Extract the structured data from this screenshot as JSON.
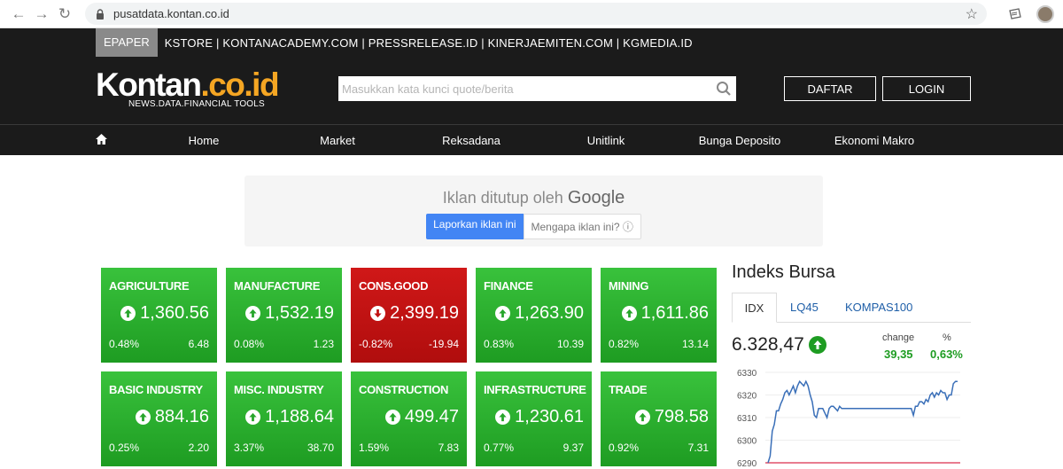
{
  "browser": {
    "url": "pusatdata.kontan.co.id"
  },
  "topbar": {
    "epaper": "EPAPER",
    "links": "KSTORE | KONTANACADEMY.COM | PRESSRELEASE.ID | KINERJAEMITEN.COM | KGMEDIA.ID"
  },
  "header": {
    "logo_main": "Kontan",
    "logo_accent": ".co.id",
    "tagline": "NEWS.DATA.FINANCIAL TOOLS",
    "search_placeholder": "Masukkan kata kunci quote/berita",
    "daftar": "DAFTAR",
    "login": "LOGIN"
  },
  "nav": [
    "Home",
    "Market",
    "Reksadana",
    "Unitlink",
    "Bunga Deposito",
    "Ekonomi Makro"
  ],
  "ad": {
    "closed_text": "Iklan ditutup oleh",
    "brand": "Google",
    "report": "Laporkan iklan ini",
    "why": "Mengapa iklan ini? ⓘ"
  },
  "sectors": [
    {
      "name": "AGRICULTURE",
      "value": "1,360.56",
      "pct": "0.48%",
      "change": "6.48",
      "direction": "up"
    },
    {
      "name": "MANUFACTURE",
      "value": "1,532.19",
      "pct": "0.08%",
      "change": "1.23",
      "direction": "up"
    },
    {
      "name": "CONS.GOOD",
      "value": "2,399.19",
      "pct": "-0.82%",
      "change": "-19.94",
      "direction": "down"
    },
    {
      "name": "FINANCE",
      "value": "1,263.90",
      "pct": "0.83%",
      "change": "10.39",
      "direction": "up"
    },
    {
      "name": "MINING",
      "value": "1,611.86",
      "pct": "0.82%",
      "change": "13.14",
      "direction": "up"
    },
    {
      "name": "BASIC INDUSTRY",
      "value": "884.16",
      "pct": "0.25%",
      "change": "2.20",
      "direction": "up"
    },
    {
      "name": "MISC. INDUSTRY",
      "value": "1,188.64",
      "pct": "3.37%",
      "change": "38.70",
      "direction": "up"
    },
    {
      "name": "CONSTRUCTION",
      "value": "499.47",
      "pct": "1.59%",
      "change": "7.83",
      "direction": "up"
    },
    {
      "name": "INFRASTRUCTURE",
      "value": "1,230.61",
      "pct": "0.77%",
      "change": "9.37",
      "direction": "up"
    },
    {
      "name": "TRADE",
      "value": "798.58",
      "pct": "0.92%",
      "change": "7.31",
      "direction": "up"
    }
  ],
  "index": {
    "title": "Indeks Bursa",
    "tabs": [
      "IDX",
      "LQ45",
      "KOMPAS100"
    ],
    "value": "6.328,47",
    "change_label": "change",
    "pct_label": "%",
    "change": "39,35",
    "pct": "0,63%",
    "colors": {
      "up": "#1e9c22",
      "line": "#3a6fb8",
      "baseline": "#e0506a"
    }
  },
  "chart_data": {
    "type": "line",
    "y_ticks": [
      "6330",
      "6320",
      "6310",
      "6300",
      "6290"
    ],
    "ylim": [
      6290,
      6330
    ],
    "baseline": 6290,
    "series": [
      {
        "values": [
          6290,
          6293,
          6304,
          6307,
          6313,
          6313,
          6316,
          6318,
          6321,
          6322,
          6320,
          6322,
          6324,
          6321,
          6324,
          6326,
          6325,
          6324,
          6326,
          6324,
          6320,
          6317,
          6311,
          6310,
          6314,
          6314,
          6314,
          6312,
          6310,
          6314,
          6315,
          6315,
          6314,
          6313,
          6315,
          6314,
          6314,
          6314,
          6314,
          6314,
          6314,
          6314,
          6314,
          6314,
          6314,
          6314,
          6314,
          6314,
          6314,
          6314,
          6314,
          6314,
          6314,
          6314,
          6314,
          6314,
          6314,
          6314,
          6314,
          6314,
          6314,
          6314,
          6314,
          6314,
          6314,
          6314,
          6314,
          6314,
          6314,
          6311,
          6315,
          6315,
          6317,
          6317,
          6316,
          6318,
          6317,
          6320,
          6321,
          6319,
          6321,
          6320,
          6322,
          6321,
          6321,
          6318,
          6320,
          6320,
          6325,
          6326,
          6326
        ]
      }
    ]
  }
}
